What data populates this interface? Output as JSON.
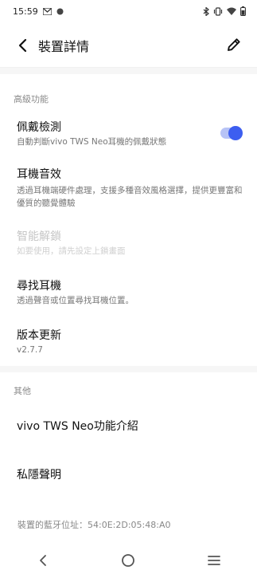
{
  "status_bar": {
    "time": "15:59",
    "icons_left": [
      "message-icon",
      "record-icon"
    ],
    "icons_right": [
      "bluetooth-icon",
      "vibrate-icon",
      "wifi-icon",
      "battery-icon"
    ]
  },
  "header": {
    "title": "裝置詳情",
    "back_icon": "back-arrow-icon",
    "edit_icon": "pencil-icon"
  },
  "sections": {
    "advanced": {
      "label": "高級功能",
      "items": [
        {
          "title": "佩戴檢測",
          "subtitle": "自動判斷vivo TWS Neo耳機的佩戴狀態",
          "toggle_on": true
        },
        {
          "title": "耳機音效",
          "subtitle": "透過耳機端硬件處理，支援多種音效風格選擇，提供更豐富和優質的聽覺體驗"
        },
        {
          "title": "智能解鎖",
          "subtitle": "如要使用，請先設定上鎖畫面",
          "disabled": true
        },
        {
          "title": "尋找耳機",
          "subtitle": "透過聲音或位置尋找耳機位置。"
        },
        {
          "title": "版本更新",
          "subtitle": "v2.7.7"
        }
      ]
    },
    "other": {
      "label": "其他",
      "items": [
        {
          "title": "vivo TWS Neo功能介紹"
        },
        {
          "title": "私隱聲明"
        }
      ]
    }
  },
  "bt_address": "裝置的藍牙位址：54:0E:2D:05:48:A0",
  "colors": {
    "accent": "#3d5ef0",
    "toggle_track": "#b7c3f6"
  },
  "nav_bar": [
    "back-triangle-icon",
    "home-circle-icon",
    "menu-lines-icon"
  ]
}
